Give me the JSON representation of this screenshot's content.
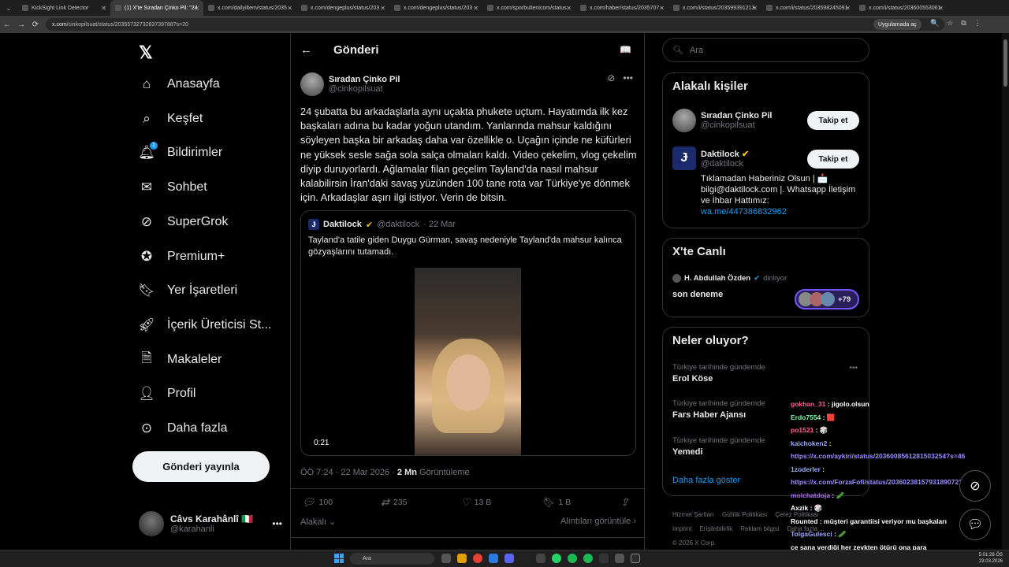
{
  "browser": {
    "tabs": [
      {
        "label": "KickSight Link Detector"
      },
      {
        "label": "(1) X'te Sıradan Çinko Pil: \"24"
      },
      {
        "label": "x.com/dailyiltem/status/2035"
      },
      {
        "label": "x.com/dengeplus/status/203"
      },
      {
        "label": "x.com/dengeplus/status/203"
      },
      {
        "label": "x.com/sporbultenicom/status"
      },
      {
        "label": "x.com/haber/status/2035707"
      },
      {
        "label": "x.com/i/status/203599391213"
      },
      {
        "label": "x.com/i/status/203598245091"
      },
      {
        "label": "x.com/i/status/203600553061"
      }
    ],
    "url_domain": "x.com",
    "url_path": "/cinkopilsuat/status/2035573273283739788?s=20",
    "app_button": "Uygulamada aç"
  },
  "nav": {
    "items": [
      {
        "label": "Anasayfa",
        "icon": "home-icon"
      },
      {
        "label": "Keşfet",
        "icon": "search-icon"
      },
      {
        "label": "Bildirimler",
        "icon": "bell-icon",
        "badge": "1"
      },
      {
        "label": "Sohbet",
        "icon": "mail-icon"
      },
      {
        "label": "SuperGrok",
        "icon": "grok-icon"
      },
      {
        "label": "Premium+",
        "icon": "premium-icon"
      },
      {
        "label": "Yer İşaretleri",
        "icon": "bookmark-icon"
      },
      {
        "label": "İçerik Üreticisi St...",
        "icon": "rocket-icon"
      },
      {
        "label": "Makaleler",
        "icon": "article-icon"
      },
      {
        "label": "Profil",
        "icon": "person-icon"
      },
      {
        "label": "Daha fazla",
        "icon": "more-circle-icon"
      }
    ],
    "post_button": "Gönderi yayınla",
    "account": {
      "name": "Câvs Karahânlî 🇮🇹",
      "handle": "@karahanli"
    }
  },
  "post": {
    "header_title": "Gönderi",
    "author_name": "Sıradan Çinko Pil",
    "author_handle": "@cinkopilsuat",
    "text": "24 şubatta bu arkadaşlarla aynı uçakta phukete uçtum. Hayatımda ilk kez başkaları adına bu kadar yoğun utandım. Yanlarında mahsur kaldığını söyleyen başka bir arkadaş daha var özellikle o. Uçağın içinde ne küfürleri ne yüksek sesle sağa sola salça olmaları kaldı. Video çekelim, vlog çekelim diyip duruyorlardı. Ağlamalar filan geçelim Tayland'da nasıl mahsur kalabilirsin İran'daki savaş yüzünden 100 tane rota var Türkiye'ye dönmek için. Arkadaşlar aşırı ilgi istiyor. Verin de bitsin.",
    "quote": {
      "name": "Daktilock",
      "handle": "@daktilock",
      "date": "· 22 Mar",
      "text": "Tayland'a tatile giden Duygu Gürman, savaş nedeniyle Tayland'da mahsur kalınca gözyaşlarını tutamadı.",
      "video_duration": "0:21"
    },
    "meta_time": "ÖÖ 7:24 · 22 Mar 2026 · ",
    "views_count": "2 Mn",
    "views_label": " Görüntüleme",
    "stats": {
      "replies": "100",
      "reposts": "235",
      "likes": "13 B",
      "bookmarks": "1 B"
    },
    "sort_label": "Alakalı",
    "quotes_link": "Alıntıları görüntüle"
  },
  "sidebar": {
    "search_placeholder": "Ara",
    "relevant": {
      "title": "Alakalı kişiler",
      "people": [
        {
          "name": "Sıradan Çinko Pil",
          "handle": "@cinkopilsuat",
          "button": "Takip et"
        },
        {
          "name": "Daktilock",
          "handle": "@daktilock",
          "button": "Takip et"
        }
      ],
      "bio": "Tıklamadan Haberiniz Olsun | 📩 bilgi@daktilock.com |. Whatsapp İletişim ve İhbar Hattımız:",
      "bio_link": "wa.me/447386832962"
    },
    "live": {
      "title": "X'te Canlı",
      "host": "H. Abdullah Özden",
      "status": "dinliyor",
      "space_title": "son deneme",
      "listeners": "+79"
    },
    "trends": {
      "title": "Neler oluyor?",
      "items": [
        {
          "category": "Türkiye tarihinde gündemde",
          "topic": "Erol Köse"
        },
        {
          "category": "Türkiye tarihinde gündemde",
          "topic": "Fars Haber Ajansı"
        },
        {
          "category": "Türkiye tarihinde gündemde",
          "topic": "Yemedi"
        }
      ],
      "more": "Daha fazla göster"
    },
    "footer": [
      "Hizmet Şartları",
      "Gizlilik Politikası",
      "Çerez Politikası",
      "Imprint",
      "Erişilebilirlik",
      "Reklam bilgisi",
      "Daha fazla ...",
      "© 2026 X Corp."
    ]
  },
  "chat": [
    {
      "user": "gokhan_31",
      "msg": "jigolo.olsun",
      "cls": "u1"
    },
    {
      "user": "Erdo7554",
      "msg": "🟥",
      "cls": "u2"
    },
    {
      "user": "po1521",
      "msg": "🎲",
      "cls": "u1"
    },
    {
      "user": "kaichoken2",
      "msg": "",
      "cls": "u4"
    },
    {
      "user": "",
      "msg": "https://x.com/aykiri/status/2036008561281503254?s=46",
      "cls": "lnk"
    },
    {
      "user": "1zoderler",
      "msg": "",
      "cls": "u4"
    },
    {
      "user": "",
      "msg": "https://x.com/ForzaFofi/status/2036023815793189072?s=20",
      "cls": "lnk"
    },
    {
      "user": "molchatdoja",
      "msg": "🥒",
      "cls": "u3"
    },
    {
      "user": "Axzik",
      "msg": "🎲",
      "cls": "w"
    },
    {
      "user": "Rounted",
      "msg": "müşteri garantiisi veriyor mu başkaları",
      "cls": "w"
    },
    {
      "user": "TolgaGulesci",
      "msg": "🥒",
      "cls": "u4"
    },
    {
      "user": "",
      "msg": "ce sana verdiği her zevkten ötürü ona para",
      "cls": "w"
    }
  ],
  "taskbar": {
    "search": "Ara",
    "time": "5:01:26 ÖS",
    "date": "23.03.2026"
  },
  "colors": {
    "accent": "#1d9bf0",
    "bg": "#000000",
    "border": "#2f3336"
  }
}
